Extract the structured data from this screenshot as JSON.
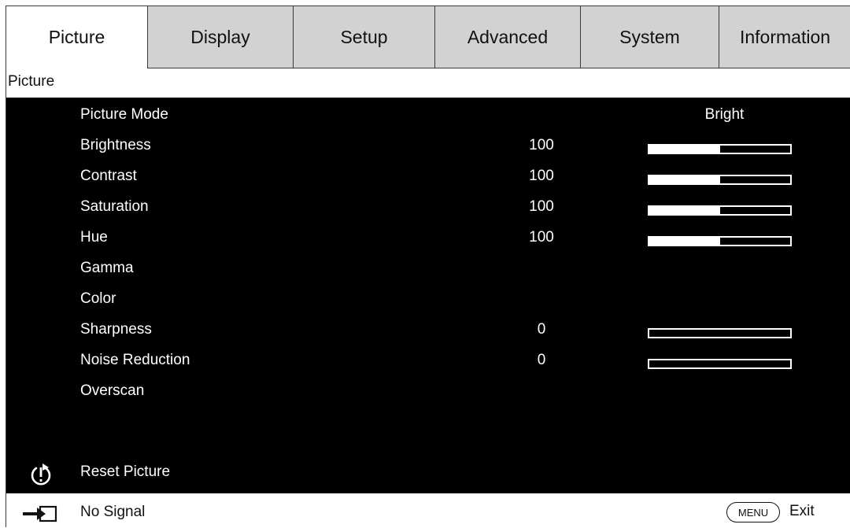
{
  "tabs": [
    {
      "label": "Picture",
      "active": true
    },
    {
      "label": "Display",
      "active": false
    },
    {
      "label": "Setup",
      "active": false
    },
    {
      "label": "Advanced",
      "active": false
    },
    {
      "label": "System",
      "active": false
    },
    {
      "label": "Information",
      "active": false
    }
  ],
  "section_title": "Picture",
  "menu": {
    "picture_mode": {
      "label": "Picture Mode",
      "value": "Bright"
    },
    "brightness": {
      "label": "Brightness",
      "value": "100",
      "level": 0.5
    },
    "contrast": {
      "label": "Contrast",
      "value": "100",
      "level": 0.5
    },
    "saturation": {
      "label": "Saturation",
      "value": "100",
      "level": 0.5
    },
    "hue": {
      "label": "Hue",
      "value": "100",
      "level": 0.5
    },
    "gamma": {
      "label": "Gamma"
    },
    "color": {
      "label": "Color"
    },
    "sharpness": {
      "label": "Sharpness",
      "value": "0",
      "level": 0
    },
    "noise_reduction": {
      "label": "Noise Reduction",
      "value": "0",
      "level": 0
    },
    "overscan": {
      "label": "Overscan"
    }
  },
  "reset": {
    "label": "Reset Picture",
    "icon": "power-reset-icon"
  },
  "status": {
    "source_icon": "input-source-icon",
    "signal_text": "No Signal",
    "menu_button": "MENU",
    "exit_label": "Exit"
  },
  "colors": {
    "panel_bg": "#000000",
    "tab_inactive": "#d2d2d2",
    "text": "#ffffff"
  }
}
